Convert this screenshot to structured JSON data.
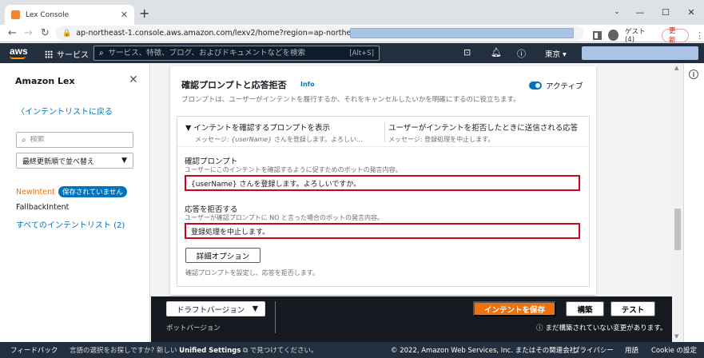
{
  "browser": {
    "tab_title": "Lex Console",
    "url": "ap-northeast-1.console.aws.amazon.com/lexv2/home?region=ap-northeast-1#bot/",
    "profile_label": "ゲスト (4)",
    "update_label": "更新"
  },
  "aws_nav": {
    "logo": "aws",
    "services_label": "サービス",
    "search_placeholder": "サービス、特徴、ブログ、およびドキュメントなどを検索",
    "search_shortcut": "[Alt+S]",
    "region_label": "東京 ▾"
  },
  "sidebar": {
    "title": "Amazon Lex",
    "back_link": "インテントリストに戻る",
    "search_placeholder": "検索",
    "sort_label": "最終更新順で並べ替え",
    "current_intent": "NewIntent",
    "unsaved_badge": "保存されていません",
    "fallback_intent": "FallbackIntent",
    "all_intents_link": "すべてのインテントリスト (2)"
  },
  "card": {
    "title": "確認プロンプトと応答拒否",
    "info_label": "Info",
    "active_label": "アクティブ",
    "active": true,
    "description": "プロンプトは、ユーザーがインテントを履行するか、それをキャンセルしたいかを明確にするのに役立ちます。",
    "header_left_title": "▼ インテントを確認するプロンプトを表示",
    "header_left_sub_prefix": "メッセージ: ",
    "header_left_sub_var": "{userName}",
    "header_left_sub_rest": " さんを登録します。よろしい...",
    "header_right_title": "ユーザーがインテントを拒否したときに送信される応答",
    "header_right_sub": "メッセージ: 登録処理を中止します。",
    "confirm_label": "確認プロンプト",
    "confirm_desc": "ユーザーにこのインテントを確認するように促すためのボットの発言内容。",
    "confirm_value": "{userName} さんを登録します。よろしいですか。",
    "decline_label": "応答を拒否する",
    "decline_desc": "ユーザーが確認プロンプトに NO と言った場合のボットの発言内容。",
    "decline_value": "登録処理を中止します。",
    "advanced_button": "詳細オプション",
    "advanced_desc": "確認プロンプトを設定し、応答を拒否します。"
  },
  "actionbar": {
    "draft_label": "ドラフトバージョン",
    "version_label": "ボットバージョン",
    "save_label": "インテントを保存",
    "build_label": "構築",
    "test_label": "テスト",
    "unbuilt_notice": "まだ構築されていない変更があります。"
  },
  "footer": {
    "feedback": "フィードバック",
    "lang_prefix": "言語の選択をお探しですか? 新しい ",
    "lang_unified": "Unified Settings",
    "lang_suffix": " で見つけてください。",
    "copyright": "© 2022, Amazon Web Services, Inc. またはその関連会社。",
    "privacy": "プライバシー",
    "terms": "用語",
    "cookie": "Cookie の設定"
  }
}
